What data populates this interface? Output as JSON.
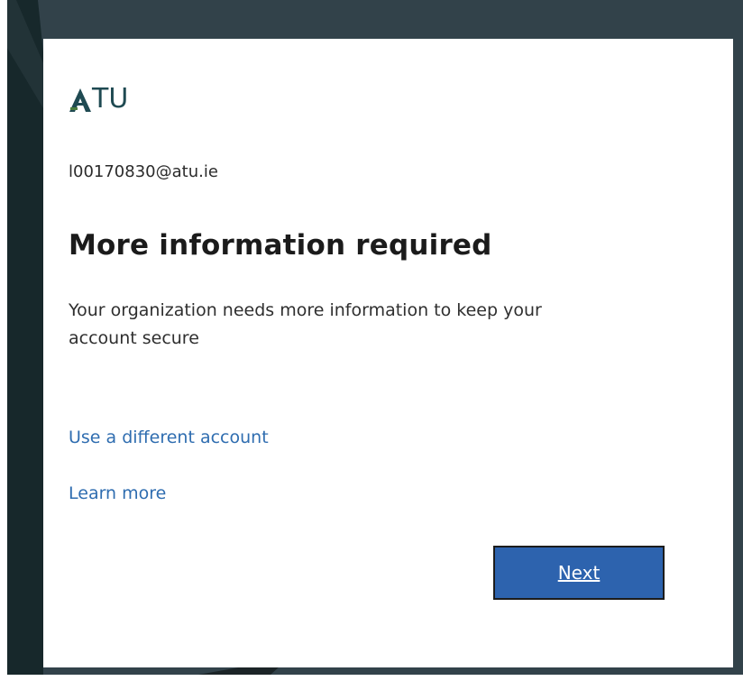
{
  "logo": {
    "text": "TU",
    "mark_glyph": "A",
    "icon_name": "atu-logo-icon",
    "color": "#1f4a52"
  },
  "identity": {
    "email": "l00170830@atu.ie"
  },
  "main": {
    "title": "More information required",
    "description": "Your organization needs more information to keep your account secure"
  },
  "links": {
    "different_account": "Use a different account",
    "learn_more": "Learn more"
  },
  "actions": {
    "next_label": "Next"
  },
  "colors": {
    "background": "#32424a",
    "card": "#ffffff",
    "link": "#2f6db0",
    "button": "#2d63ae",
    "title": "#1b1b1b"
  }
}
